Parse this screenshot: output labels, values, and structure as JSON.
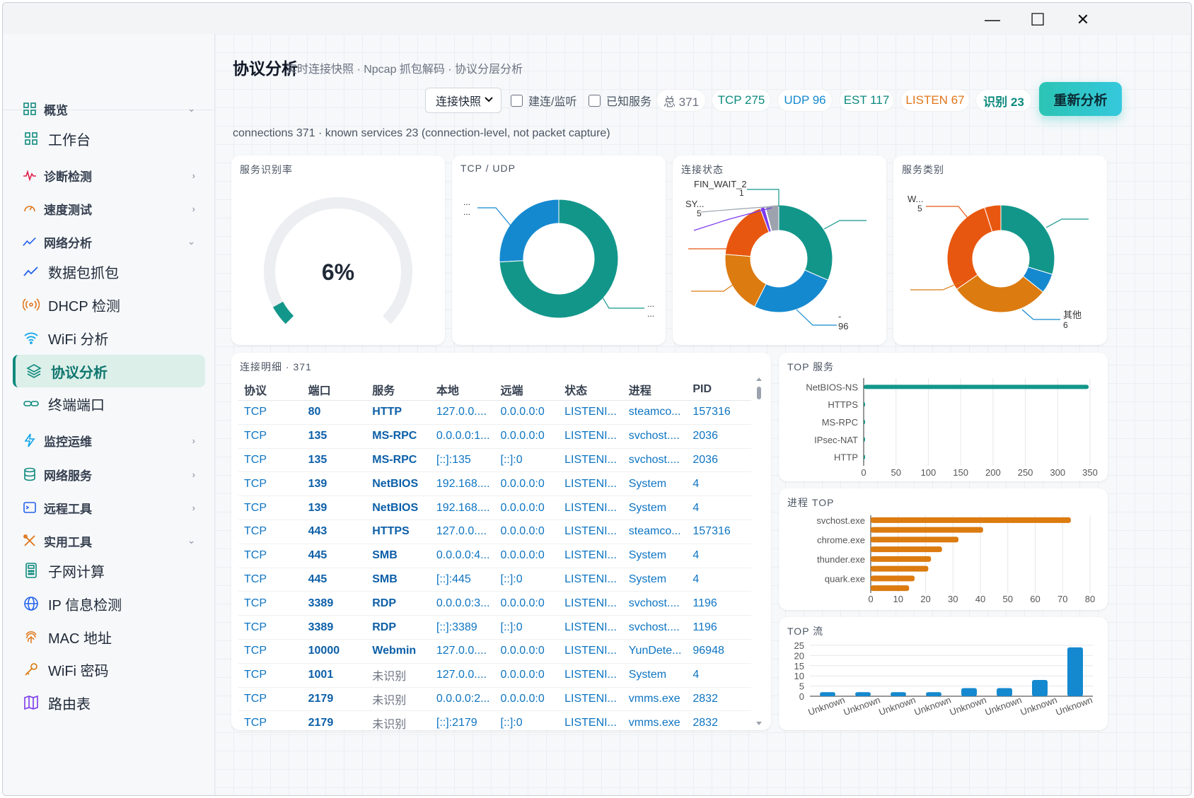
{
  "window": {
    "minimize": "—",
    "maximize": "☐",
    "close": "✕"
  },
  "sidebar": {
    "items": [
      {
        "name": "sidebar-group-overview",
        "label": "概览",
        "group": true,
        "chev": "⌄",
        "icon": "grid-icon"
      },
      {
        "name": "sidebar-item-workbench",
        "label": "工作台",
        "group": false,
        "icon": "grid-icon"
      },
      {
        "name": "sidebar-group-diagnostics",
        "label": "诊断检测",
        "group": true,
        "chev": "›",
        "icon": "pulse-icon"
      },
      {
        "name": "sidebar-group-speedtest",
        "label": "速度测试",
        "group": true,
        "chev": "›",
        "icon": "gauge-icon"
      },
      {
        "name": "sidebar-group-network-analysis",
        "label": "网络分析",
        "group": true,
        "chev": "⌄",
        "icon": "trend-icon"
      },
      {
        "name": "sidebar-item-packet-capture",
        "label": "数据包抓包",
        "group": false,
        "icon": "trend-icon"
      },
      {
        "name": "sidebar-item-dhcp",
        "label": "DHCP 检测",
        "group": false,
        "icon": "broadcast-icon"
      },
      {
        "name": "sidebar-item-wifi-analysis",
        "label": "WiFi 分析",
        "group": false,
        "icon": "wifi-icon"
      },
      {
        "name": "sidebar-item-protocol-analysis",
        "label": "协议分析",
        "group": false,
        "active": true,
        "icon": "layers-icon"
      },
      {
        "name": "sidebar-item-terminal-ports",
        "label": "终端端口",
        "group": false,
        "icon": "link-icon"
      },
      {
        "name": "sidebar-group-monitoring",
        "label": "监控运维",
        "group": true,
        "chev": "›",
        "icon": "bolt-icon"
      },
      {
        "name": "sidebar-group-network-services",
        "label": "网络服务",
        "group": true,
        "chev": "›",
        "icon": "database-icon"
      },
      {
        "name": "sidebar-group-remote-tools",
        "label": "远程工具",
        "group": true,
        "chev": "›",
        "icon": "terminal-icon"
      },
      {
        "name": "sidebar-group-utilities",
        "label": "实用工具",
        "group": true,
        "chev": "⌄",
        "icon": "tools-icon"
      },
      {
        "name": "sidebar-item-subnet-calc",
        "label": "子网计算",
        "group": false,
        "icon": "calculator-icon"
      },
      {
        "name": "sidebar-item-ip-info",
        "label": "IP 信息检测",
        "group": false,
        "icon": "globe-icon"
      },
      {
        "name": "sidebar-item-mac-address",
        "label": "MAC 地址",
        "group": false,
        "icon": "fingerprint-icon"
      },
      {
        "name": "sidebar-item-wifi-password",
        "label": "WiFi 密码",
        "group": false,
        "icon": "key-icon"
      },
      {
        "name": "sidebar-item-route-table",
        "label": "路由表",
        "group": false,
        "icon": "map-icon"
      }
    ]
  },
  "header": {
    "title": "协议分析",
    "subtitle": "实时连接快照 · Npcap 抓包解码 · 协议分层分析"
  },
  "toolbar": {
    "mode_select": "连接快照",
    "checkbox_established": "建连/监听",
    "checkbox_known": "已知服务",
    "stats": {
      "total": "总 371",
      "tcp": "TCP 275",
      "udp": "UDP 96",
      "est": "EST 117",
      "listen": "LISTEN 67",
      "identified": "识别 23"
    },
    "reanalyze": "重新分析"
  },
  "summary": "connections 371 · known services 23 (connection-level, not packet capture)",
  "colors": {
    "teal": "#13968a",
    "blue": "#1589cf",
    "orange": "#dc7b10",
    "red_orange": "#e8570f",
    "purple": "#7c3aed",
    "gray": "#9ca3af",
    "listen": "#e0761a",
    "accent": "#2bc4b4"
  },
  "cards": {
    "gauge": {
      "title": "服务识别率",
      "value": "6%"
    },
    "tcp_udp": {
      "title": "TCP / UDP",
      "label_a": "...",
      "label_a2": "...",
      "label_b": "...",
      "label_b2": "..."
    },
    "conn_state": {
      "title": "连接状态",
      "label_fin": "FIN_WAIT_2",
      "label_fin_v": "1",
      "label_syn": "SY...",
      "label_syn_v": "5",
      "label_dash": "-",
      "label_dash_v": "96"
    },
    "svc_category": {
      "title": "服务类别",
      "label_w": "W...",
      "label_w_v": "5",
      "label_other": "其他",
      "label_other_v": "6"
    },
    "detail": {
      "title": "连接明细 · 371"
    },
    "top_services": {
      "title": "TOP 服务"
    },
    "top_process": {
      "title": "进程 TOP"
    },
    "top_flows": {
      "title": "TOP 流"
    }
  },
  "table": {
    "headers": [
      "协议",
      "端口",
      "服务",
      "本地",
      "远端",
      "状态",
      "进程",
      "PID"
    ],
    "rows": [
      [
        "TCP",
        "80",
        "HTTP",
        "127.0.0....",
        "0.0.0.0:0",
        "LISTENI...",
        "steamco...",
        "157316"
      ],
      [
        "TCP",
        "135",
        "MS-RPC",
        "0.0.0.0:1...",
        "0.0.0.0:0",
        "LISTENI...",
        "svchost....",
        "2036"
      ],
      [
        "TCP",
        "135",
        "MS-RPC",
        "[::]:135",
        "[::]:0",
        "LISTENI...",
        "svchost....",
        "2036"
      ],
      [
        "TCP",
        "139",
        "NetBIOS",
        "192.168....",
        "0.0.0.0:0",
        "LISTENI...",
        "System",
        "4"
      ],
      [
        "TCP",
        "139",
        "NetBIOS",
        "192.168....",
        "0.0.0.0:0",
        "LISTENI...",
        "System",
        "4"
      ],
      [
        "TCP",
        "443",
        "HTTPS",
        "127.0.0....",
        "0.0.0.0:0",
        "LISTENI...",
        "steamco...",
        "157316"
      ],
      [
        "TCP",
        "445",
        "SMB",
        "0.0.0.0:4...",
        "0.0.0.0:0",
        "LISTENI...",
        "System",
        "4"
      ],
      [
        "TCP",
        "445",
        "SMB",
        "[::]:445",
        "[::]:0",
        "LISTENI...",
        "System",
        "4"
      ],
      [
        "TCP",
        "3389",
        "RDP",
        "0.0.0.0:3...",
        "0.0.0.0:0",
        "LISTENI...",
        "svchost....",
        "1196"
      ],
      [
        "TCP",
        "3389",
        "RDP",
        "[::]:3389",
        "[::]:0",
        "LISTENI...",
        "svchost....",
        "1196"
      ],
      [
        "TCP",
        "10000",
        "Webmin",
        "127.0.0....",
        "0.0.0.0:0",
        "LISTENI...",
        "YunDete...",
        "96948"
      ],
      [
        "TCP",
        "1001",
        "未识别",
        "127.0.0....",
        "0.0.0.0:0",
        "LISTENI...",
        "System",
        "4"
      ],
      [
        "TCP",
        "2179",
        "未识别",
        "0.0.0.0:2...",
        "0.0.0.0:0",
        "LISTENI...",
        "vmms.exe",
        "2832"
      ],
      [
        "TCP",
        "2179",
        "未识别",
        "[::]:2179",
        "[::]:0",
        "LISTENI...",
        "vmms.exe",
        "2832"
      ]
    ]
  },
  "chart_data": [
    {
      "type": "gauge",
      "title": "服务识别率",
      "value": 6,
      "max": 100
    },
    {
      "type": "pie",
      "title": "TCP / UDP",
      "series": [
        {
          "values": [
            275,
            96
          ]
        }
      ]
    },
    {
      "type": "pie",
      "title": "连接状态",
      "labels": [
        "",
        "-",
        "",
        "",
        "SY...",
        "FIN_WAIT_2",
        ""
      ],
      "values": [
        117,
        96,
        70,
        67,
        5,
        1,
        15
      ]
    },
    {
      "type": "pie",
      "title": "服务类别",
      "labels": [
        "",
        "其他",
        "",
        "",
        "W..."
      ],
      "values": [
        30,
        6,
        30,
        30,
        5
      ]
    },
    {
      "type": "bar",
      "orientation": "horizontal",
      "title": "TOP 服务",
      "categories": [
        "NetBIOS-NS",
        "HTTPS",
        "MS-RPC",
        "IPsec-NAT",
        "HTTP"
      ],
      "values": [
        348,
        2,
        2,
        2,
        1
      ],
      "xlim": [
        0,
        350
      ],
      "xticks": [
        0,
        50,
        100,
        150,
        200,
        250,
        300,
        350
      ]
    },
    {
      "type": "bar",
      "orientation": "horizontal",
      "title": "进程 TOP",
      "categories": [
        "svchost.exe",
        "",
        "chrome.exe",
        "",
        "thunder.exe",
        "",
        "quark.exe",
        ""
      ],
      "values": [
        73,
        41,
        32,
        26,
        22,
        21,
        16,
        14
      ],
      "xlim": [
        0,
        80
      ],
      "xticks": [
        0,
        10,
        20,
        30,
        40,
        50,
        60,
        70,
        80
      ]
    },
    {
      "type": "bar",
      "title": "TOP 流",
      "categories": [
        "Unknown",
        "Unknown",
        "Unknown",
        "Unknown",
        "Unknown",
        "Unknown",
        "Unknown",
        "Unknown"
      ],
      "values": [
        2,
        2,
        2,
        2,
        4,
        4,
        8,
        24
      ],
      "ylim": [
        0,
        25
      ],
      "yticks": [
        0,
        5,
        10,
        15,
        20,
        25
      ]
    }
  ]
}
